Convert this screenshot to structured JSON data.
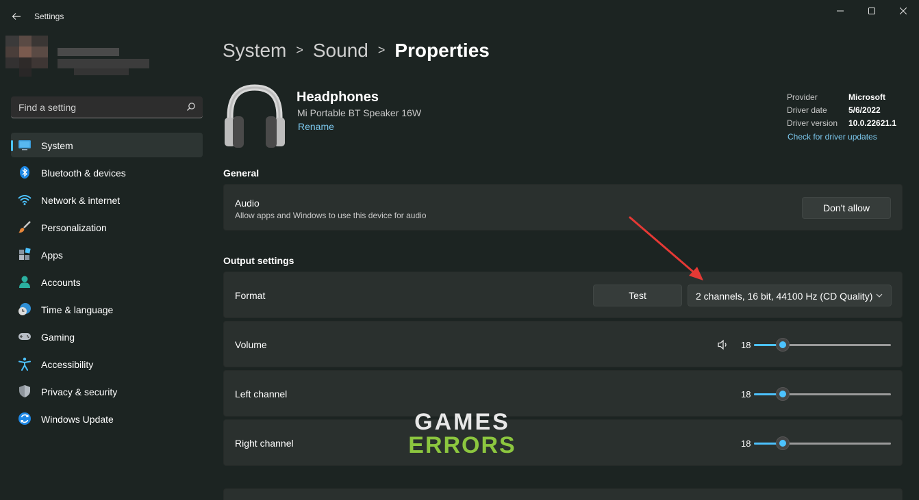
{
  "app": {
    "title": "Settings"
  },
  "search": {
    "placeholder": "Find a setting"
  },
  "sidebar": {
    "items": [
      {
        "label": "System",
        "icon": "system-icon",
        "active": true
      },
      {
        "label": "Bluetooth & devices",
        "icon": "bluetooth-icon"
      },
      {
        "label": "Network & internet",
        "icon": "network-icon"
      },
      {
        "label": "Personalization",
        "icon": "brush-icon"
      },
      {
        "label": "Apps",
        "icon": "apps-icon"
      },
      {
        "label": "Accounts",
        "icon": "accounts-icon"
      },
      {
        "label": "Time & language",
        "icon": "time-language-icon"
      },
      {
        "label": "Gaming",
        "icon": "gaming-icon"
      },
      {
        "label": "Accessibility",
        "icon": "accessibility-icon"
      },
      {
        "label": "Privacy & security",
        "icon": "shield-icon"
      },
      {
        "label": "Windows Update",
        "icon": "windows-update-icon"
      }
    ]
  },
  "breadcrumb": {
    "parts": [
      "System",
      "Sound"
    ],
    "current": "Properties"
  },
  "device": {
    "name": "Headphones",
    "model": "Mi Portable BT Speaker 16W",
    "rename_label": "Rename"
  },
  "driver": {
    "provider_label": "Provider",
    "provider_value": "Microsoft",
    "date_label": "Driver date",
    "date_value": "5/6/2022",
    "version_label": "Driver version",
    "version_value": "10.0.22621.1",
    "update_link": "Check for driver updates"
  },
  "general": {
    "heading": "General",
    "audio_title": "Audio",
    "audio_desc": "Allow apps and Windows to use this device for audio",
    "audio_button": "Don't allow"
  },
  "output": {
    "heading": "Output settings",
    "format_label": "Format",
    "test_button": "Test",
    "format_value": "2 channels, 16 bit, 44100 Hz (CD Quality)",
    "volume_label": "Volume",
    "volume_value": "18",
    "left_label": "Left channel",
    "left_value": "18",
    "right_label": "Right channel",
    "right_value": "18"
  },
  "watermark": {
    "top": "GAMES",
    "bottom": "ERRORS"
  },
  "colors": {
    "accent": "#4cc2ff",
    "link": "#7cc8ee",
    "annotation_arrow": "#e53935",
    "watermark_green": "#8cc63f"
  }
}
